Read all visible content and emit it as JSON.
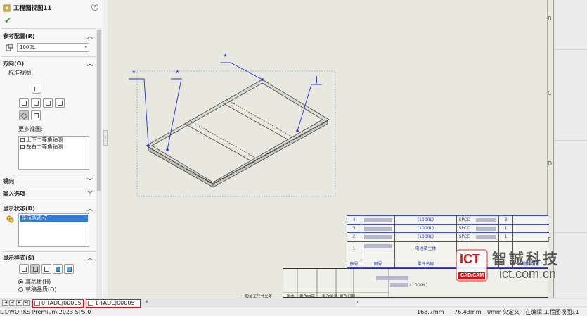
{
  "panel": {
    "title": "工程图视图11",
    "help": "?",
    "ok": "✔",
    "ref_config_label": "参考配置(R)",
    "config_value": "1000L",
    "orientation_label": "方向(O)",
    "standard_views_label": "标准视图:",
    "more_views_label": "更多视图:",
    "more_views": [
      "上下二等角轴测",
      "左右二等角轴测"
    ],
    "mirror_label": "镜向",
    "import_label": "输入选项",
    "display_state_label": "显示状态(D)",
    "display_state_item": "显示状态-7",
    "display_style_label": "显示样式(S)",
    "hq_label": "高品质(H)",
    "draft_label": "草稿品质(Q)"
  },
  "sheet": {
    "zones": [
      "B",
      "C",
      "D",
      "E"
    ],
    "balloons": [
      "*",
      "*",
      "*",
      "|"
    ]
  },
  "bom": {
    "rows": [
      {
        "no": "4",
        "desc": "(1000L)",
        "mat": "SPCC",
        "qty": "3"
      },
      {
        "no": "3",
        "desc": "(1000L)",
        "mat": "SPCC",
        "qty": "1"
      },
      {
        "no": "2",
        "desc": "(1000L)",
        "mat": "SPCC",
        "qty": "1"
      },
      {
        "no": "1",
        "desc": "电池箱主体",
        "mat": "",
        "qty": ""
      }
    ],
    "header": {
      "no": "序号",
      "code": "图号",
      "name": "零件名称",
      "mat": "",
      "qty": "",
      "code2": "物料编号"
    }
  },
  "titleblock": {
    "name": "(1000L)",
    "cols": [
      "一般加工尺寸公差",
      "版本",
      "更改内容",
      "更改单号",
      "更改日期"
    ]
  },
  "tabs": [
    "0-TADCJ00005",
    "1-TADCJ00005"
  ],
  "status": {
    "app": "LIDWORKS Premium 2023 SP5.0",
    "x": "168.7mm",
    "y": "76.43mm",
    "z": "0mm",
    "defined": "欠定义",
    "editing": "在编辑 工程图视图11"
  },
  "watermark": {
    "brand_cn": "智誠科技",
    "badge": "ICT",
    "sub": "CAD/CAM",
    "url": "ict.com.cn"
  },
  "colors": {
    "accent": "#2f7bd8",
    "blue_lines": "#3b4bd6",
    "red": "#d11111"
  }
}
